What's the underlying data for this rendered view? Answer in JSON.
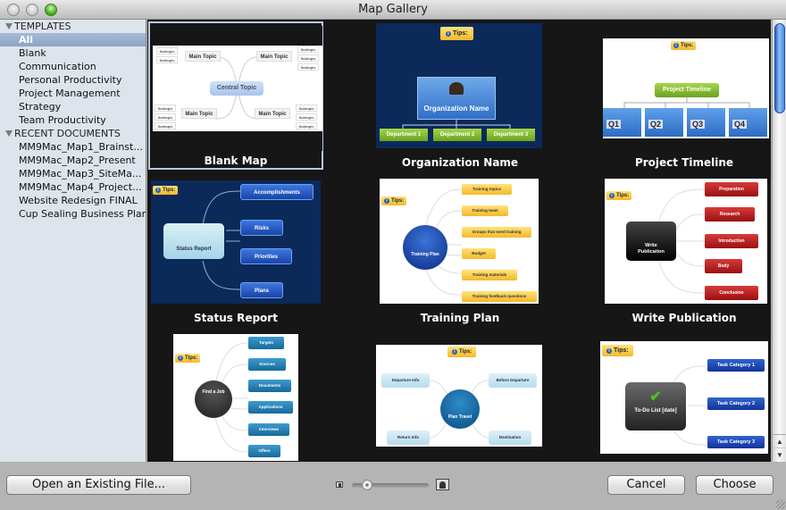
{
  "window": {
    "title": "Map Gallery"
  },
  "sidebar": {
    "sections": [
      {
        "header": "TEMPLATES",
        "items": [
          "All",
          "Blank",
          "Communication",
          "Personal Productivity",
          "Project Management",
          "Strategy",
          "Team Productivity"
        ],
        "selected": "All"
      },
      {
        "header": "RECENT DOCUMENTS",
        "items": [
          "MM9Mac_Map1_Brainst...",
          "MM9Mac_Map2_Present",
          "MM9Mac_Map3_SiteMa...",
          "MM9Mac_Map4_Project...",
          "Website Redesign FINAL",
          "Cup Sealing Business Plan"
        ]
      }
    ]
  },
  "gallery": {
    "selected": "Blank Map",
    "tips_label": "Tips:",
    "templates": [
      {
        "label": "Blank Map",
        "central": "Central Topic",
        "main": "Main Topic",
        "sub": "Subtopic"
      },
      {
        "label": "Organization Name",
        "central": "Organization Name",
        "children": [
          "Department 1",
          "Department 2",
          "Department 3"
        ]
      },
      {
        "label": "Project Timeline",
        "central": "Project Timeline",
        "children": [
          "Q1",
          "Q2",
          "Q3",
          "Q4"
        ]
      },
      {
        "label": "Status Report",
        "central": "Status Report",
        "children": [
          "Accomplishments",
          "Risks",
          "Priorities",
          "Plans"
        ]
      },
      {
        "label": "Training Plan",
        "central": "Training Plan",
        "children": [
          "Training topics",
          "Training team",
          "Groups that need training",
          "Budget",
          "Training materials",
          "Training feedback questions"
        ]
      },
      {
        "label": "Write Publication",
        "central": "Write Publication",
        "children": [
          "Preparation",
          "Research",
          "Introduction",
          "Body",
          "Conclusion"
        ]
      },
      {
        "label": "",
        "central": "Find a Job",
        "children": [
          "Targets",
          "Sources",
          "Documents",
          "Applications",
          "Interviews",
          "Offers"
        ]
      },
      {
        "label": "",
        "central": "Plan Travel",
        "children": [
          "Departure Info",
          "Before Departure",
          "Return Info",
          "Destination"
        ]
      },
      {
        "label": "",
        "central": "To-Do List [date]",
        "children": [
          "Task Category 1",
          "Task Category 2",
          "Task Category 3"
        ]
      }
    ]
  },
  "scroll": {
    "position_fraction": 0.0,
    "visible_fraction": 0.22
  },
  "footer": {
    "open_button": "Open an Existing File...",
    "cancel_button": "Cancel",
    "choose_button": "Choose",
    "thumbnail_size_fraction": 0.2,
    "small_icon": "small-thumbnail-icon",
    "large_icon": "large-thumbnail-icon"
  },
  "colors": {
    "gallery_bg": "#161616",
    "sidebar_bg": "#dde4ec",
    "selection": "#8ea4c6",
    "org_bg": "#0b2a5a",
    "dept_green": "#7cb82a",
    "tips_yellow": "#f5b92a",
    "timeline_blue": "#3a86d8",
    "training_orange": "#fbc94a",
    "publication_red": "#b3161c",
    "todo_blue": "#1b48b0"
  }
}
